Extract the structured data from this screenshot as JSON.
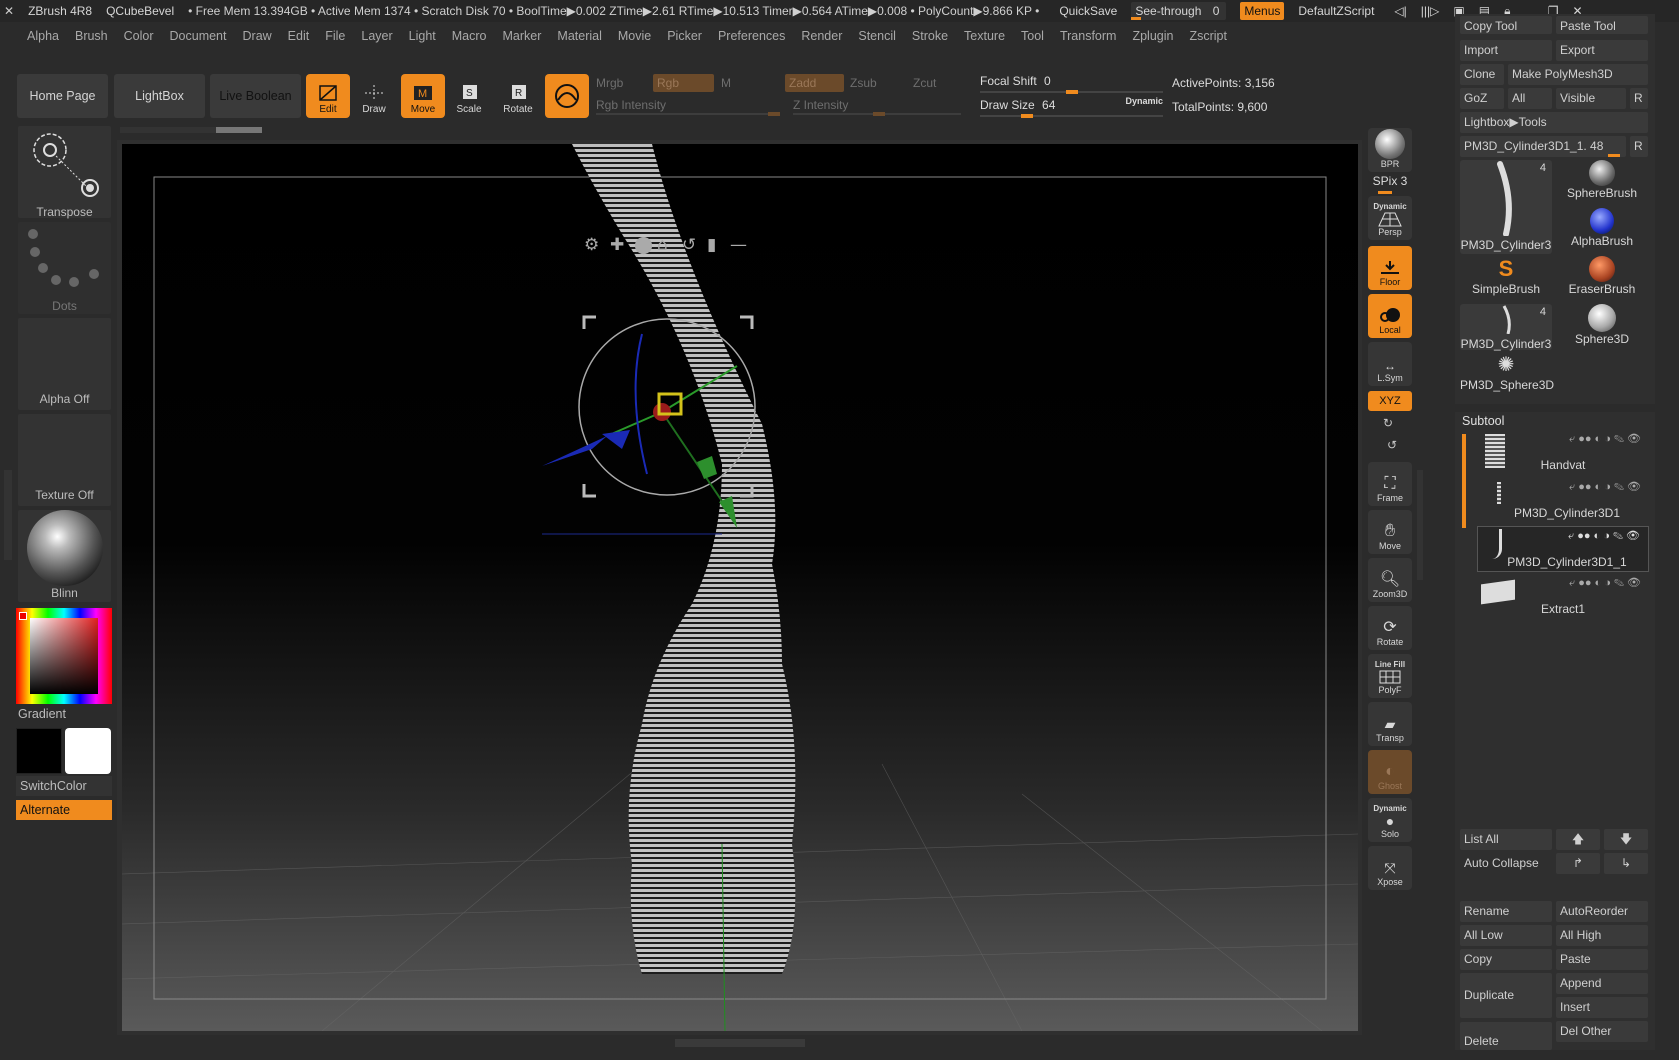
{
  "titlebar": {
    "app": "ZBrush 4R8",
    "doc": "QCubeBevel",
    "stats": "• Free Mem 13.394GB • Active Mem 1374 • Scratch Disk 70 •  BoolTime▶0.002 ZTime▶2.61 RTime▶10.513 Timer▶0.564 ATime▶0.008 • PolyCount▶9.866 KP •",
    "quicksave": "QuickSave",
    "see_through_label": "See-through",
    "see_through_value": "0",
    "menus": "Menus",
    "defaultzscript": "DefaultZScript"
  },
  "menubar": [
    "Alpha",
    "Brush",
    "Color",
    "Document",
    "Draw",
    "Edit",
    "File",
    "Layer",
    "Light",
    "Macro",
    "Marker",
    "Material",
    "Movie",
    "Picker",
    "Preferences",
    "Render",
    "Stencil",
    "Stroke",
    "Texture",
    "Tool",
    "Transform",
    "Zplugin",
    "Zscript"
  ],
  "topshelf": {
    "home_page": "Home Page",
    "lightbox": "LightBox",
    "live_boolean": "Live Boolean",
    "edit": "Edit",
    "draw": "Draw",
    "move": "Move",
    "scale": "Scale",
    "rotate": "Rotate",
    "mrgb": "Mrgb",
    "rgb": "Rgb",
    "m": "M",
    "rgb_intensity": "Rgb Intensity",
    "zadd": "Zadd",
    "zsub": "Zsub",
    "zcut": "Zcut",
    "z_intensity": "Z Intensity",
    "focal_shift_label": "Focal Shift",
    "focal_shift_value": "0",
    "draw_size_label": "Draw Size",
    "draw_size_value": "64",
    "dynamic": "Dynamic",
    "active_points": "ActivePoints: 3,156",
    "total_points": "TotalPoints: 9,600"
  },
  "leftshelf": {
    "transpose": "Transpose",
    "dots": "Dots",
    "alpha_off": "Alpha Off",
    "texture_off": "Texture Off",
    "material": "Blinn",
    "gradient": "Gradient",
    "switchcolor": "SwitchColor",
    "alternate": "Alternate"
  },
  "rightshelf": {
    "bpr": "BPR",
    "spix_label": "SPix",
    "spix_value": "3",
    "dynamic": "Dynamic",
    "persp": "Persp",
    "floor": "Floor",
    "local": "Local",
    "lsym": "L.Sym",
    "xyz": "XYZ",
    "frame": "Frame",
    "move": "Move",
    "zoom3d": "Zoom3D",
    "rotate": "Rotate",
    "line_fill": "Line Fill",
    "polyf": "PolyF",
    "transp": "Transp",
    "ghost": "Ghost",
    "dynamic2": "Dynamic",
    "solo": "Solo",
    "xpose": "Xpose"
  },
  "toolpanel": {
    "copy_tool": "Copy Tool",
    "paste_tool": "Paste Tool",
    "import": "Import",
    "export": "Export",
    "clone": "Clone",
    "make_polymesh": "Make PolyMesh3D",
    "goz": "GoZ",
    "all": "All",
    "visible": "Visible",
    "r": "R",
    "lightbox_tools": "Lightbox▶Tools",
    "current_tool": "PM3D_Cylinder3D1_1. 48",
    "tools": [
      {
        "name": "PM3D_Cylinder3",
        "badge": "4"
      },
      {
        "name": "SphereBrush",
        "badge": ""
      },
      {
        "name": "AlphaBrush",
        "badge": ""
      },
      {
        "name": "SimpleBrush",
        "badge": ""
      },
      {
        "name": "EraserBrush",
        "badge": ""
      },
      {
        "name": "PM3D_Cylinder3",
        "badge": "4"
      },
      {
        "name": "Sphere3D",
        "badge": ""
      },
      {
        "name": "PM3D_Sphere3D",
        "badge": ""
      }
    ]
  },
  "subtool": {
    "header": "Subtool",
    "items": [
      "Handvat",
      "PM3D_Cylinder3D1",
      "PM3D_Cylinder3D1_1",
      "Extract1"
    ],
    "list_all": "List All",
    "auto_collapse": "Auto Collapse",
    "rename": "Rename",
    "autoreorder": "AutoReorder",
    "all_low": "All Low",
    "all_high": "All High",
    "copy": "Copy",
    "paste": "Paste",
    "duplicate": "Duplicate",
    "append": "Append",
    "insert": "Insert",
    "delete": "Delete",
    "del_other": "Del Other"
  },
  "colors": {
    "accent": "#f08b1e",
    "panel": "#2b2b2b",
    "button": "#3a3a3a"
  }
}
